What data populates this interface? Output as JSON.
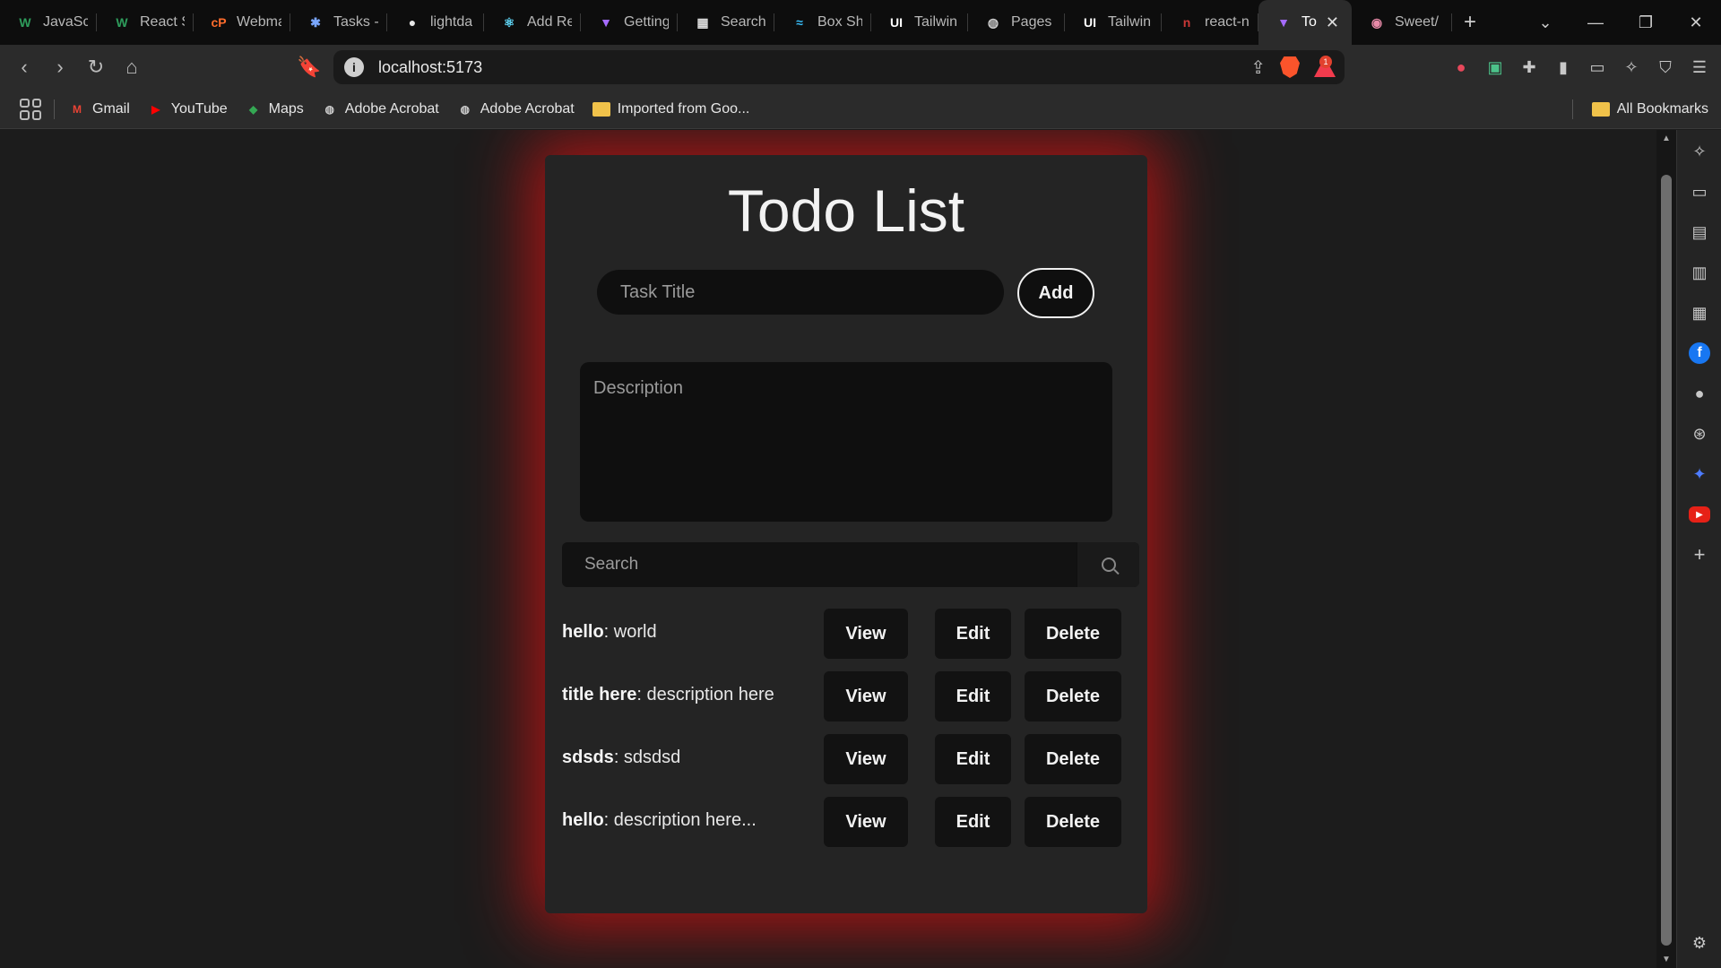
{
  "browser": {
    "tabs": [
      {
        "label": "JavaScr",
        "icon": "W",
        "icon_color": "#2e9d5c",
        "active": false
      },
      {
        "label": "React S",
        "icon": "W",
        "icon_color": "#2e9d5c",
        "active": false
      },
      {
        "label": "Webma",
        "icon": "cP",
        "icon_color": "#ff6c2c",
        "active": false
      },
      {
        "label": "Tasks -",
        "icon": "✱",
        "icon_color": "#7aa7ff",
        "active": false
      },
      {
        "label": "lightda",
        "icon": "●",
        "icon_color": "#e6e6e6",
        "active": false
      },
      {
        "label": "Add Re",
        "icon": "⚛",
        "icon_color": "#61dafb",
        "active": false
      },
      {
        "label": "Getting",
        "icon": "▼",
        "icon_color": "#a56bff",
        "active": false
      },
      {
        "label": "Search",
        "icon": "▦",
        "icon_color": "#dddddd",
        "active": false
      },
      {
        "label": "Box Sh",
        "icon": "≈",
        "icon_color": "#38bdf8",
        "active": false
      },
      {
        "label": "Tailwin",
        "icon": "UI",
        "icon_color": "#ffffff",
        "active": false
      },
      {
        "label": "Pages -",
        "icon": "◍",
        "icon_color": "#cccccc",
        "active": false
      },
      {
        "label": "Tailwin",
        "icon": "UI",
        "icon_color": "#ffffff",
        "active": false
      },
      {
        "label": "react-n",
        "icon": "n",
        "icon_color": "#cb3837",
        "active": false
      },
      {
        "label": "To",
        "icon": "▼",
        "icon_color": "#a56bff",
        "active": true
      },
      {
        "label": "Sweet/",
        "icon": "◉",
        "icon_color": "#e88aa8",
        "active": false
      }
    ],
    "url": "localhost:5173",
    "rewards_badge": "1",
    "bookmarks": [
      {
        "label": "Gmail",
        "icon": "M",
        "icon_color": "#ea4335"
      },
      {
        "label": "YouTube",
        "icon": "▶",
        "icon_color": "#ff0000"
      },
      {
        "label": "Maps",
        "icon": "◆",
        "icon_color": "#34a853"
      },
      {
        "label": "Adobe Acrobat",
        "icon": "◍",
        "icon_color": "#cccccc"
      },
      {
        "label": "Adobe Acrobat",
        "icon": "◍",
        "icon_color": "#cccccc"
      },
      {
        "label": "Imported from Goo...",
        "icon": "folder",
        "icon_color": "#f0c24a"
      }
    ],
    "all_bookmarks": "All Bookmarks"
  },
  "app": {
    "title": "Todo List",
    "task_placeholder": "Task Title",
    "add_label": "Add",
    "description_placeholder": "Description",
    "search_placeholder": "Search",
    "view_label": "View",
    "edit_label": "Edit",
    "delete_label": "Delete",
    "todos": [
      {
        "title": "hello",
        "description": ": world"
      },
      {
        "title": "title here",
        "description": ": description here"
      },
      {
        "title": "sdsds",
        "description": ": sdsdsd"
      },
      {
        "title": "hello",
        "description": ": description here..."
      }
    ]
  },
  "colors": {
    "glow": "#be1414",
    "card": "#242424",
    "page": "#1c1c1c",
    "field": "#0f0f0f"
  }
}
